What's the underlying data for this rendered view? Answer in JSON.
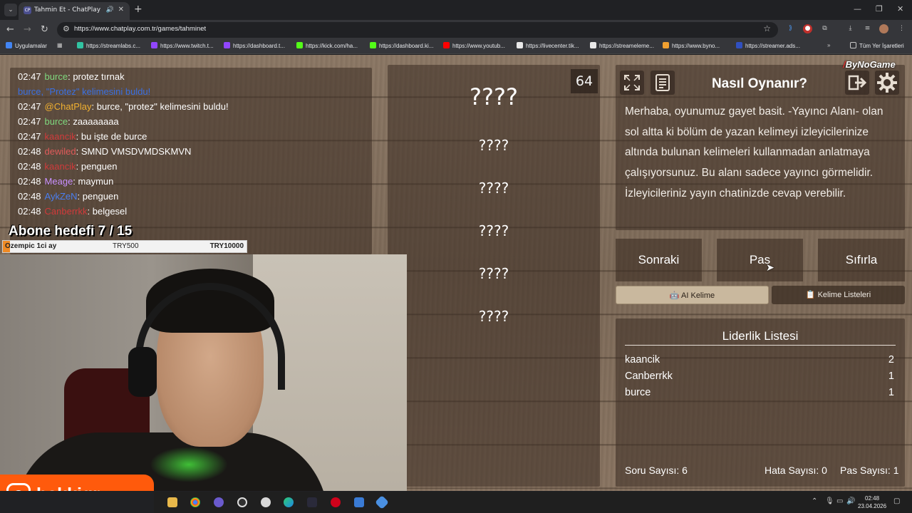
{
  "browser": {
    "tab_title": "Tahmin Et - ChatPlay",
    "tab_favicon": "CP",
    "url": "https://www.chatplay.com.tr/games/tahminet",
    "bookmarks": [
      {
        "label": "Uygulamalar",
        "icon": "apps-grid-icon",
        "color": "#4285f4"
      },
      {
        "label": "https://streamlabs.c...",
        "icon": "streamlabs-icon",
        "color": "#31c3a2"
      },
      {
        "label": "https://www.twitch.t...",
        "icon": "twitch-icon",
        "color": "#9146ff"
      },
      {
        "label": "https://dashboard.t...",
        "icon": "twitch-icon",
        "color": "#9146ff"
      },
      {
        "label": "https://kick.com/ha...",
        "icon": "kick-icon",
        "color": "#53fc18"
      },
      {
        "label": "https://dashboard.ki...",
        "icon": "kick-icon",
        "color": "#53fc18"
      },
      {
        "label": "https://www.youtub...",
        "icon": "youtube-icon",
        "color": "#ff0000"
      },
      {
        "label": "https://livecenter.tik...",
        "icon": "tiktok-icon",
        "color": "#e8e8e8"
      },
      {
        "label": "https://streameleme...",
        "icon": "streamelements-icon",
        "color": "#e8e8e8"
      },
      {
        "label": "https://www.byno...",
        "icon": "bynogame-icon",
        "color": "#f0a030"
      },
      {
        "label": "https://streamer.ads...",
        "icon": "ads-icon",
        "color": "#3050c0"
      }
    ],
    "all_bookmarks": "Tüm Yer İşaretleri"
  },
  "chat": {
    "lines": [
      {
        "time": "02:47",
        "user": "burce",
        "user_color": "#7fd97f",
        "sep": ": ",
        "text": "protez tırnak",
        "text_color": "#ffffff"
      },
      {
        "time": "",
        "user": "",
        "user_color": "#ffffff",
        "sep": "",
        "text": "burce, \"Protez\" kelimesini buldu!",
        "text_color": "#3a6fe0"
      },
      {
        "time": "02:47",
        "user": "@ChatPlay",
        "user_color": "#f0b030",
        "sep": ": ",
        "text": "burce, \"protez\" kelimesini buldu!",
        "text_color": "#ffffff"
      },
      {
        "time": "02:47",
        "user": "burce",
        "user_color": "#7fd97f",
        "sep": ": ",
        "text": "zaaaaaaaa",
        "text_color": "#ffffff"
      },
      {
        "time": "02:47",
        "user": "kaancik",
        "user_color": "#d03a3a",
        "sep": ": ",
        "text": "bu işte de burce",
        "text_color": "#ffffff"
      },
      {
        "time": "02:48",
        "user": "dewiled",
        "user_color": "#e05a5a",
        "sep": ": ",
        "text": "SMND VMSDVMDSKMVN",
        "text_color": "#ffffff"
      },
      {
        "time": "02:48",
        "user": "kaancik",
        "user_color": "#d03a3a",
        "sep": ": ",
        "text": "penguen",
        "text_color": "#ffffff"
      },
      {
        "time": "02:48",
        "user": "Meage",
        "user_color": "#c890ff",
        "sep": ": ",
        "text": "maymun",
        "text_color": "#ffffff"
      },
      {
        "time": "02:48",
        "user": "AykZeN",
        "user_color": "#4a7ef0",
        "sep": ": ",
        "text": "penguen",
        "text_color": "#ffffff"
      },
      {
        "time": "02:48",
        "user": "Canberrkk",
        "user_color": "#d03a3a",
        "sep": ": ",
        "text": "belgesel",
        "text_color": "#ffffff"
      }
    ]
  },
  "game": {
    "remaining_count": "64",
    "words": [
      "????",
      "????",
      "????",
      "????",
      "????",
      "????"
    ]
  },
  "howto": {
    "title": "Nasıl Oynanır?",
    "text": "Merhaba, oyunumuz gayet basit. -Yayıncı Alanı- olan sol altta ki bölüm de yazan kelimeyi izleyicilerinize altında bulunan kelimeleri kullanmadan anlatmaya çalışıyorsunuz. Bu alanı sadece yayıncı görmelidir. İzleyicileriniz yayın chatinizde cevap verebilir.",
    "brand": "ByNoGame",
    "brand_mark": "/"
  },
  "actions": {
    "next": "Sonraki",
    "pass": "Pas",
    "reset": "Sıfırla",
    "ai_word": "AI Kelime",
    "word_lists": "Kelime Listeleri"
  },
  "leaderboard": {
    "title": "Liderlik Listesi",
    "rows": [
      {
        "name": "kaancik",
        "score": "2"
      },
      {
        "name": "Canberrkk",
        "score": "1"
      },
      {
        "name": "burce",
        "score": "1"
      }
    ]
  },
  "stats": {
    "questions": "Soru Sayısı: 6",
    "errors": "Hata Sayısı: 0",
    "passes": "Pas Sayısı: 1"
  },
  "overlay": {
    "sub_goal": "Abone hedefi 7 / 15",
    "goal_progress": 0.03,
    "goal_left": "Ozempic 1ci ay",
    "goal_mid": "TRY500",
    "goal_right": "TRY10000",
    "instagram_handle": "hakkigr"
  },
  "taskbar": {
    "time": "02:48",
    "date": "23.04.2026"
  }
}
